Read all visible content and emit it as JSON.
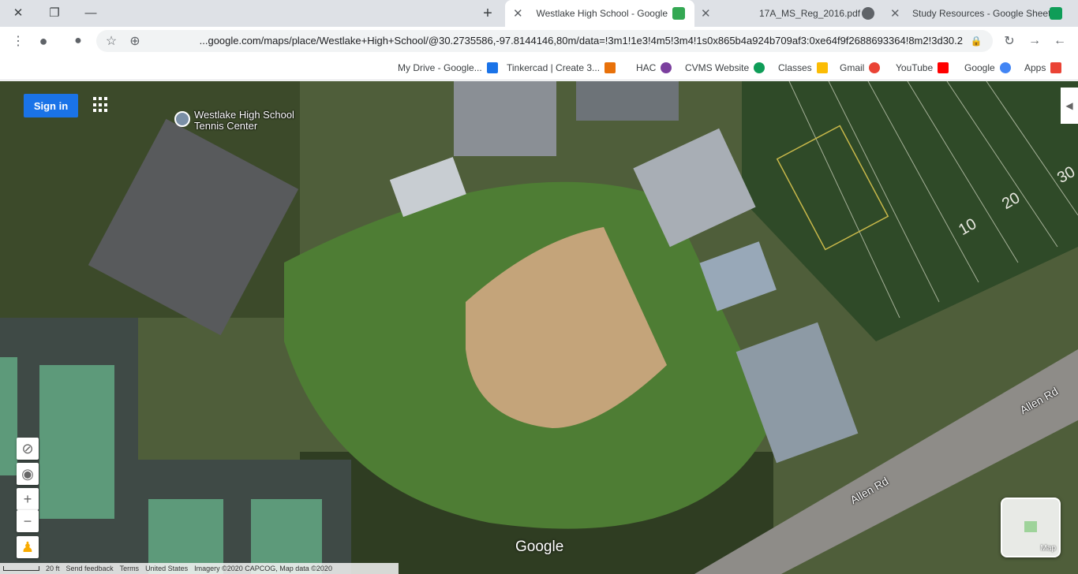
{
  "window": {
    "close": "✕",
    "maximize": "❐",
    "minimize": "—"
  },
  "tabs": [
    {
      "title": "Westlake High School - Google",
      "active": true,
      "color": "#34a853"
    },
    {
      "title": "17A_MS_Reg_2016.pdf",
      "active": false,
      "color": "#5f6368"
    },
    {
      "title": "Study Resources - Google Sheets",
      "active": false,
      "color": "#0f9d58"
    }
  ],
  "new_tab": "+",
  "toolbar": {
    "url": "google.com/maps/place/Westlake+High+School/@30.2735586,-97.8144146,80m/data=!3m1!1e3!4m5!3m4!1s0x865b4a924b709af3:0xe64f9f2688693364!8m2!3d30.2...",
    "back_icon": "back-arrow-icon",
    "forward_icon": "forward-arrow-icon",
    "reload_icon": "reload-icon"
  },
  "bookmarks": [
    {
      "label": "Apps",
      "color": "#ea4335"
    },
    {
      "label": "Google",
      "color": "#4285f4"
    },
    {
      "label": "YouTube",
      "color": "#ff0000"
    },
    {
      "label": "Gmail",
      "color": "#ea4335"
    },
    {
      "label": "Classes",
      "color": "#fbbc04"
    },
    {
      "label": "CVMS Website",
      "color": "#0f9d58"
    },
    {
      "label": "HAC",
      "color": "#7b3f9e"
    },
    {
      "label": "Tinkercad | Create 3...",
      "color": "#e8710a"
    },
    {
      "label": "My Drive - Google...",
      "color": "#1a73e8"
    }
  ],
  "map": {
    "sign_in": "Sign in",
    "place_label": "Westlake High School Tennis Center",
    "road_label": "Allen Rd",
    "yard_20": "20",
    "yard_10": "10",
    "yard_30": "30",
    "watermark": "Google",
    "minimap_label": "Map",
    "zoom_in": "+",
    "zoom_out": "−",
    "footer": {
      "imagery": "Imagery ©2020 CAPCOG, Map data ©2020",
      "country": "United States",
      "terms": "Terms",
      "feedback": "Send feedback",
      "scale": "20 ft"
    }
  }
}
